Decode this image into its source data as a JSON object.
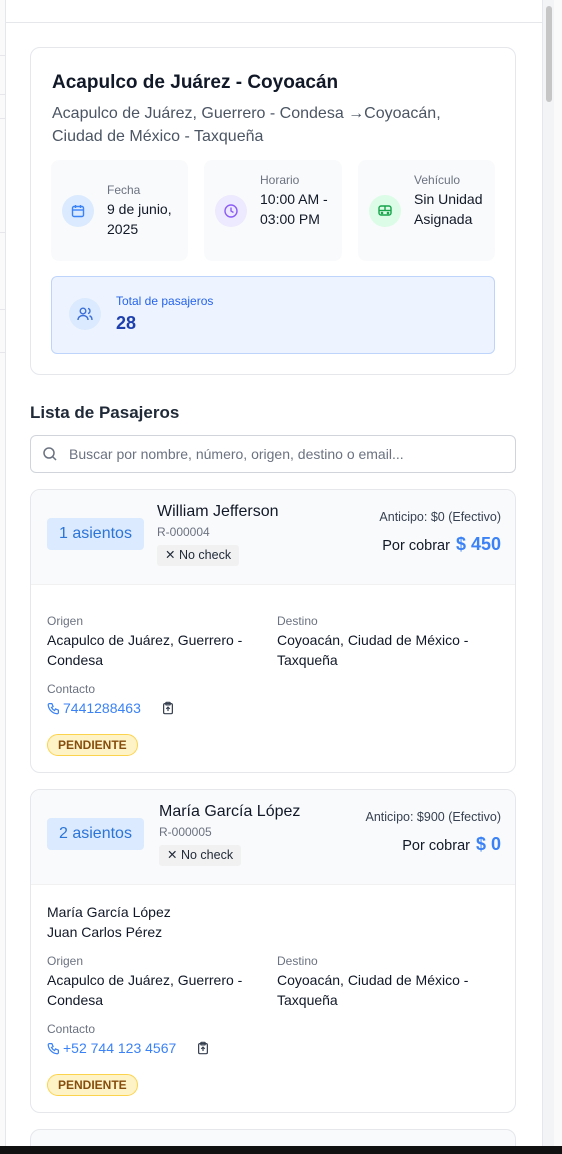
{
  "route": {
    "title": "Acapulco de Juárez - Coyoacán",
    "subtitle": "Acapulco de Juárez, Guerrero - Condesa →Coyoacán, Ciudad de México - Taxqueña",
    "fecha_label": "Fecha",
    "fecha_value": "9 de junio, 2025",
    "horario_label": "Horario",
    "horario_value": "10:00 AM - 03:00 PM",
    "vehiculo_label": "Vehículo",
    "vehiculo_value": "Sin Unidad Asignada",
    "total_label": "Total de pasajeros",
    "total_value": "28"
  },
  "list": {
    "title": "Lista de Pasajeros",
    "search_placeholder": "Buscar por nombre, número, origen, destino o email..."
  },
  "passengers": [
    {
      "seats": "1 asientos",
      "name": "William Jefferson",
      "code": "R-000004",
      "check": "No check",
      "anticipo": "Anticipo: $0 (Efectivo)",
      "cobrar_label": "Por cobrar",
      "cobrar_amount": "$ 450",
      "companions": [],
      "origen_label": "Origen",
      "origen": "Acapulco de Juárez, Guerrero - Condesa",
      "destino_label": "Destino",
      "destino": "Coyoacán, Ciudad de México - Taxqueña",
      "contacto_label": "Contacto",
      "phone": "7441288463",
      "status": "PENDIENTE"
    },
    {
      "seats": "2 asientos",
      "name": "María García López",
      "code": "R-000005",
      "check": "No check",
      "anticipo": "Anticipo: $900 (Efectivo)",
      "cobrar_label": "Por cobrar",
      "cobrar_amount": "$ 0",
      "companions": [
        "María García López",
        "Juan Carlos Pérez"
      ],
      "origen_label": "Origen",
      "origen": "Acapulco de Juárez, Guerrero - Condesa",
      "destino_label": "Destino",
      "destino": "Coyoacán, Ciudad de México - Taxqueña",
      "contacto_label": "Contacto",
      "phone": "+52 744 123 4567",
      "status": "PENDIENTE"
    }
  ],
  "colors": {
    "accent": "#3b82f6",
    "status_bg": "#fef3c7",
    "status_text": "#854d0e"
  }
}
